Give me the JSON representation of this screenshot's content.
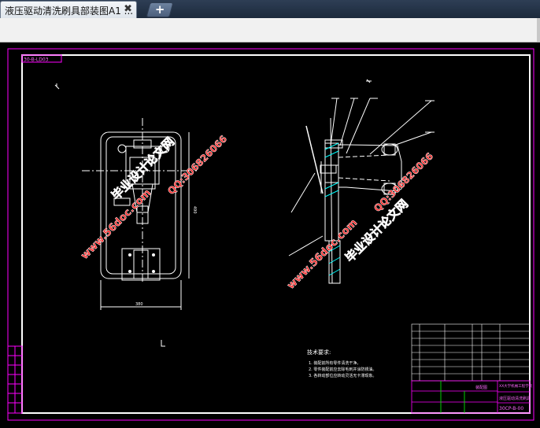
{
  "tab": {
    "title": "液压驱动清洗刷具部装图A1 ...",
    "close": "✖"
  },
  "newtab": {
    "label": "+"
  },
  "drawing": {
    "code_top": "30-B-LD03",
    "tech_title": "技术要求:",
    "tech_notes": [
      "1. 装配前所有零件清洗干净。",
      "2. 零件装配前应去除毛刺并涂防锈油。",
      "3. 各转动部位应转动灵活无卡滞现象。"
    ],
    "dim_width": "380",
    "dim_height": "490",
    "title_block": {
      "school": "XX大学机械工程学院",
      "name": "液压驱动清洗刷具",
      "code": "30CP-B-00",
      "stage": "装配图"
    }
  },
  "watermarks": {
    "left_main": "毕业设计论文网",
    "left_url": "www.56doc.com",
    "left_qq": "QQ:306826066",
    "right_main": "毕业设计论文网",
    "right_url": "www.56doc.com",
    "right_qq": "QQ:306826066"
  },
  "colors": {
    "line": "#ffffff",
    "frame": "#ff00ff",
    "watermark": "#ff2a2a",
    "accent": "#00ffff"
  }
}
